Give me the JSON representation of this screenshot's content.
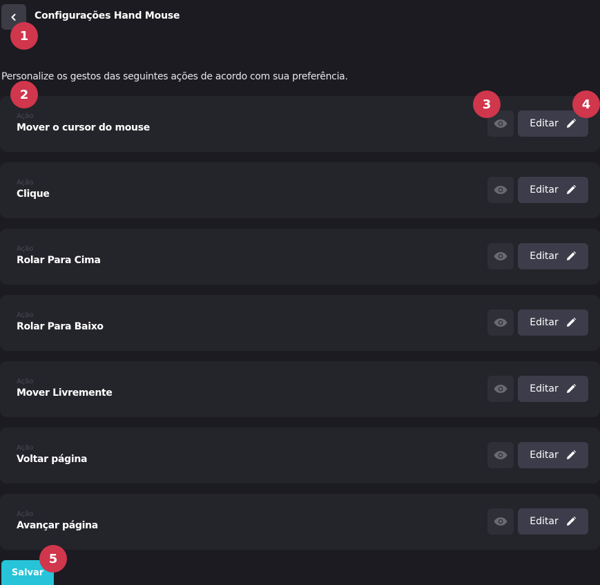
{
  "header": {
    "back_icon": "chevron-left-icon",
    "title": "Configurações Hand Mouse"
  },
  "description": "Personalize os gestos das seguintes ações de acordo com sua preferência.",
  "actions": [
    {
      "label": "Ação",
      "name": "Mover o cursor do mouse",
      "edit_label": "Editar"
    },
    {
      "label": "Ação",
      "name": "Clique",
      "edit_label": "Editar"
    },
    {
      "label": "Ação",
      "name": "Rolar Para Cima",
      "edit_label": "Editar"
    },
    {
      "label": "Ação",
      "name": "Rolar Para Baixo",
      "edit_label": "Editar"
    },
    {
      "label": "Ação",
      "name": "Mover Livremente",
      "edit_label": "Editar"
    },
    {
      "label": "Ação",
      "name": "Voltar página",
      "edit_label": "Editar"
    },
    {
      "label": "Ação",
      "name": "Avançar página",
      "edit_label": "Editar"
    }
  ],
  "icons": {
    "view": "eye-icon",
    "edit": "pencil-icon"
  },
  "save_label": "Salvar",
  "markers": [
    "1",
    "2",
    "3",
    "4",
    "5"
  ],
  "colors": {
    "background": "#1b1b21",
    "card": "#24242b",
    "edit_button": "#3c3c4a",
    "save_button": "#27c3d8",
    "marker": "#d0364c"
  }
}
